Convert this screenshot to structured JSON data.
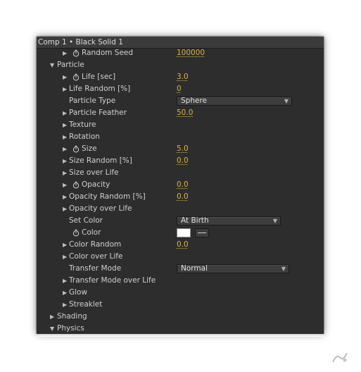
{
  "header": {
    "title": "Comp 1 • Black Solid 1"
  },
  "rows": {
    "random_seed": {
      "label": "Random Seed",
      "value": "100000"
    },
    "particle": {
      "label": "Particle"
    },
    "life": {
      "label": "Life [sec]",
      "value": "3.0"
    },
    "life_random": {
      "label": "Life Random [%]",
      "value": "0"
    },
    "particle_type": {
      "label": "Particle Type",
      "selected": "Sphere"
    },
    "particle_feather": {
      "label": "Particle Feather",
      "value": "50.0"
    },
    "texture": {
      "label": "Texture"
    },
    "rotation": {
      "label": "Rotation"
    },
    "size": {
      "label": "Size",
      "value": "5.0"
    },
    "size_random": {
      "label": "Size Random [%]",
      "value": "0.0"
    },
    "size_over_life": {
      "label": "Size over Life"
    },
    "opacity": {
      "label": "Opacity",
      "value": "0.0"
    },
    "opacity_random": {
      "label": "Opacity Random [%]",
      "value": "0.0"
    },
    "opacity_over_life": {
      "label": "Opacity over Life"
    },
    "set_color": {
      "label": "Set Color",
      "selected": "At Birth"
    },
    "color": {
      "label": "Color",
      "swatch": "#ffffff"
    },
    "color_random": {
      "label": "Color Random",
      "value": "0.0"
    },
    "color_over_life": {
      "label": "Color over Life"
    },
    "transfer_mode": {
      "label": "Transfer Mode",
      "selected": "Normal"
    },
    "transfer_mode_over_life": {
      "label": "Transfer Mode over Life"
    },
    "glow": {
      "label": "Glow"
    },
    "streaklet": {
      "label": "Streaklet"
    },
    "shading": {
      "label": "Shading"
    },
    "physics": {
      "label": "Physics"
    }
  },
  "colors": {
    "panel_bg": "#2d2d2d",
    "header_bg": "#3b3b3b",
    "label_text": "#d0d0d0",
    "value_accent": "#d8b24a"
  },
  "icons": {
    "expand": "triangle-right",
    "collapse": "triangle-down",
    "stopwatch": "stopwatch-icon"
  }
}
